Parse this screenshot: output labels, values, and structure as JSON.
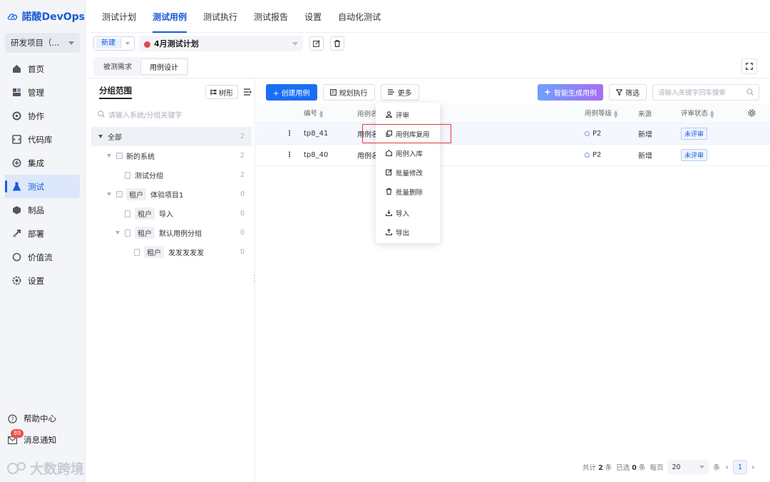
{
  "app": {
    "logo_text": "諾酸DevOps"
  },
  "sidebar": {
    "project": "研发项目（...",
    "items": [
      {
        "label": "首页",
        "icon": "home-icon"
      },
      {
        "label": "管理",
        "icon": "manage-icon"
      },
      {
        "label": "协作",
        "icon": "collab-icon"
      },
      {
        "label": "代码库",
        "icon": "repo-icon"
      },
      {
        "label": "集成",
        "icon": "integration-icon"
      },
      {
        "label": "测试",
        "icon": "flask-icon",
        "active": true
      },
      {
        "label": "制品",
        "icon": "artifact-icon"
      },
      {
        "label": "部署",
        "icon": "deploy-icon"
      },
      {
        "label": "价值流",
        "icon": "valuestream-icon"
      },
      {
        "label": "设置",
        "icon": "settings-icon"
      }
    ],
    "help": "帮助中心",
    "notify": "消息通知",
    "notify_count": "89",
    "watermark": "大数跨境"
  },
  "top_tabs": [
    "测试计划",
    "测试用例",
    "测试执行",
    "测试报告",
    "设置",
    "自动化测试"
  ],
  "plan_bar": {
    "new_label": "新建",
    "plan_name": "4月测试计划"
  },
  "sub_tabs": [
    "被测需求",
    "用例设计"
  ],
  "tree": {
    "title": "分组范围",
    "tree_btn": "树形",
    "search_placeholder": "请输入系统/分组关键字",
    "nodes": [
      {
        "label": "全部",
        "count": "2"
      },
      {
        "label": "新的系统",
        "count": "2"
      },
      {
        "label": "测试分组",
        "count": "2"
      },
      {
        "tag": "租户",
        "label": "体验项目1",
        "count": "0"
      },
      {
        "tag": "租户",
        "label": "导入",
        "count": "0"
      },
      {
        "tag": "租户",
        "label": "默认用例分组",
        "count": "0"
      },
      {
        "tag": "租户",
        "label": "发发发发发",
        "count": "0"
      }
    ]
  },
  "toolbar": {
    "create": "+ 创建用例",
    "plan_exec": "规划执行",
    "more": "更多",
    "ai_gen": "智能生成用例",
    "filter": "筛选",
    "search_placeholder": "请输入关键字回车搜索"
  },
  "table": {
    "headers": {
      "num": "编号",
      "name": "用例名",
      "level": "用例等级",
      "src": "来源",
      "status": "评审状态"
    },
    "rows": [
      {
        "num": "tp8_41",
        "name": "用例名",
        "level": "P2",
        "src": "新增",
        "status": "未评审"
      },
      {
        "num": "tp8_40",
        "name": "用例名",
        "level": "P2",
        "src": "新增",
        "status": "未评审"
      }
    ]
  },
  "dropdown": [
    "评审",
    "用例库复用",
    "用例入库",
    "批量修改",
    "批量删除",
    "导入",
    "导出"
  ],
  "pager": {
    "total_pre": "共计",
    "total": "2",
    "total_unit": "条",
    "sel_pre": "已选",
    "selected": "0",
    "sel_unit": "条",
    "per_page": "每页",
    "page_size": "20",
    "size_unit": "条",
    "page": "1"
  }
}
